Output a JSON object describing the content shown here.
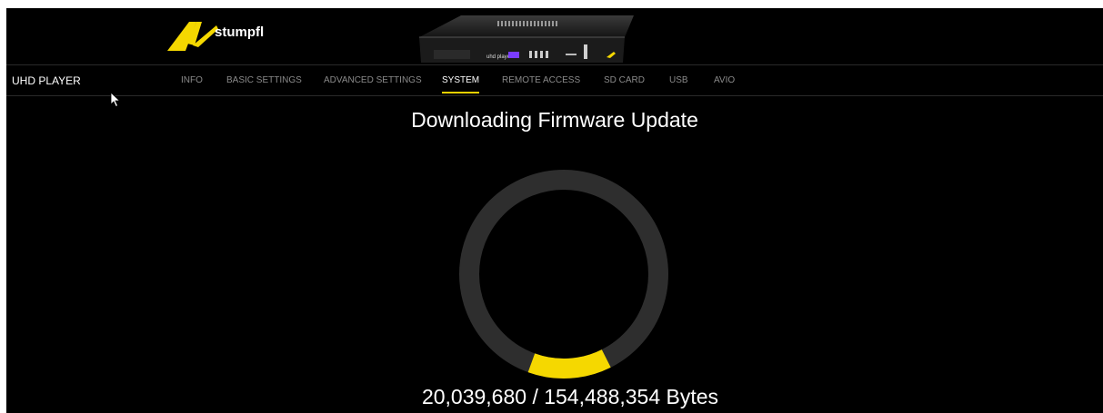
{
  "brand": {
    "logo_text": "stumpfl",
    "logo_mark": "AV",
    "accent_color": "#f0d000"
  },
  "device": {
    "label": "uhd player"
  },
  "nav": {
    "app_title": "UHD PLAYER",
    "tabs": [
      {
        "label": "INFO",
        "active": false
      },
      {
        "label": "BASIC SETTINGS",
        "active": false
      },
      {
        "label": "ADVANCED SETTINGS",
        "active": false
      },
      {
        "label": "SYSTEM",
        "active": true
      },
      {
        "label": "REMOTE ACCESS",
        "active": false
      },
      {
        "label": "SD CARD",
        "active": false
      },
      {
        "label": "USB",
        "active": false
      },
      {
        "label": "AVIO",
        "active": false
      }
    ]
  },
  "status": {
    "title": "Downloading Firmware Update",
    "bytes_text": "20,039,680 / 154,488,354 Bytes",
    "downloaded_bytes": 20039680,
    "total_bytes": 154488354,
    "ring_track_color": "#2e2e2e",
    "ring_fill_color": "#f5d800"
  }
}
